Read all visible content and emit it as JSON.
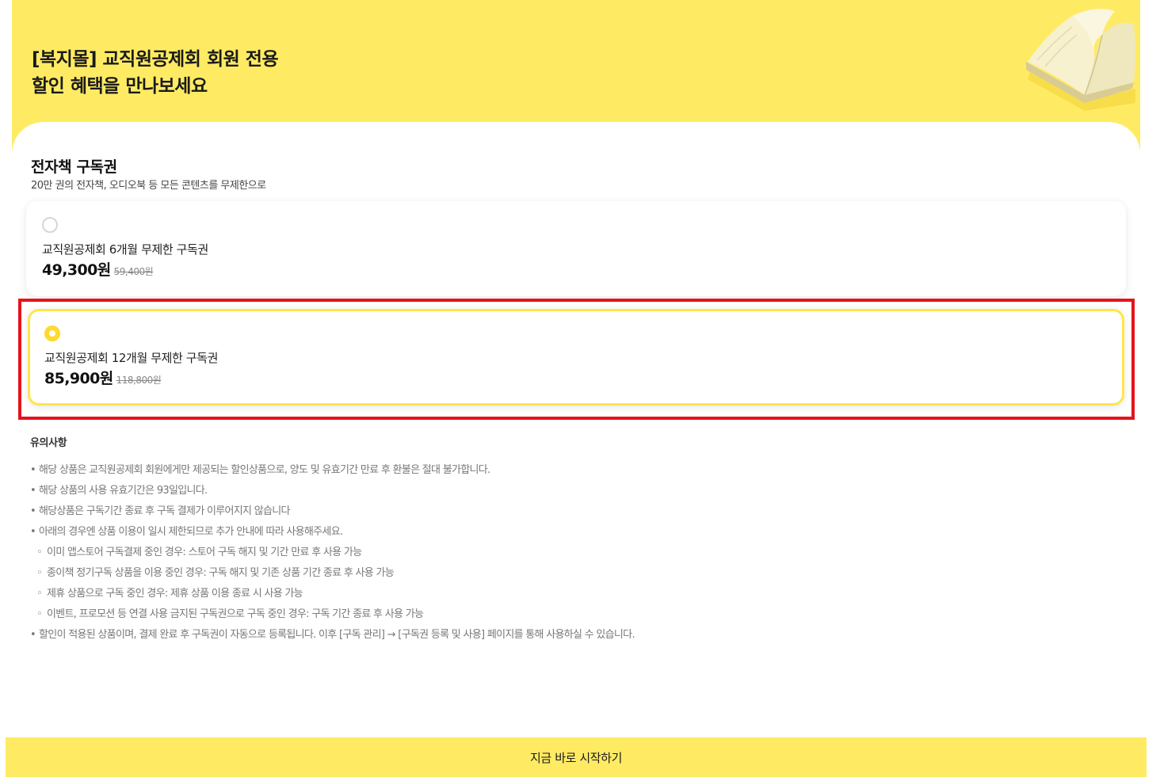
{
  "hero": {
    "title_line1": "[복지몰] 교직원공제회 회원 전용",
    "title_line2": "할인 혜택을 만나보세요"
  },
  "subscription": {
    "title": "전자책 구독권",
    "subtitle": "20만 권의 전자책, 오디오북 등 모든 콘텐츠를 무제한으로",
    "options": [
      {
        "name": "교직원공제회 6개월 무제한 구독권",
        "price": "49,300원",
        "original_price": "59,400원",
        "selected": false
      },
      {
        "name": "교직원공제회 12개월 무제한 구독권",
        "price": "85,900원",
        "original_price": "118,800원",
        "selected": true
      }
    ]
  },
  "notice": {
    "title": "유의사항",
    "items": [
      "해당 상품은 교직원공제회 회원에게만 제공되는 할인상품으로, 양도 및 유효기간 만료 후 환불은 절대 불가합니다.",
      "해당 상품의 사용 유효기간은 93일입니다.",
      "해당상품은 구독기간 종료 후 구독 결제가 이루어지지 않습니다",
      "아래의 경우엔 상품 이용이 일시 제한되므로 추가 안내에 따라 사용해주세요."
    ],
    "sub_items": [
      "이미 앱스토어 구독결제 중인 경우: 스토어 구독 해지 및 기간 만료 후 사용 가능",
      "종이책 정기구독 상품을 이용 중인 경우: 구독 해지 및 기존 상품 기간 종료 후 사용 가능",
      "제휴 상품으로 구독 중인 경우: 제휴 상품 이용 종료 시 사용 가능",
      "이벤트, 프로모션 등 연결 사용 금지된 구독권으로 구독 중인 경우: 구독 기간 종료 후 사용 가능"
    ],
    "final_item": "할인이 적용된 상품이며, 결제 완료 후 구독권이 자동으로 등록됩니다. 이후 [구독 관리] → [구독권 등록 및 사용] 페이지를 통해 사용하실 수 있습니다."
  },
  "cta": {
    "label": "지금 바로 시작하기"
  },
  "colors": {
    "brand_yellow": "#ffeb63",
    "selected_border": "#ffe54d",
    "highlight_red": "#e5131c"
  }
}
